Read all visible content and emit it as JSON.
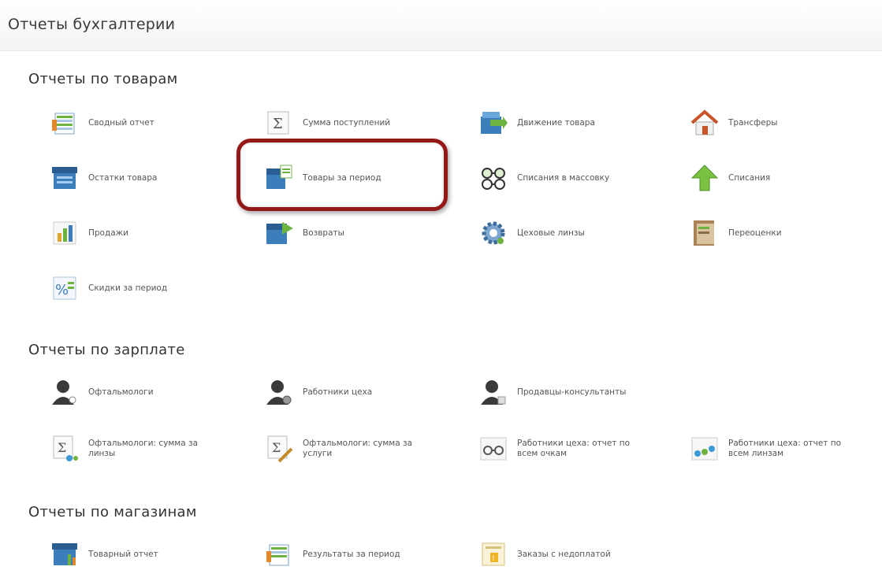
{
  "page": {
    "title": "Отчеты бухгалтерии"
  },
  "sections": [
    {
      "title": "Отчеты по товарам",
      "items": [
        {
          "label": "Сводный отчет",
          "icon": "summary-report-icon"
        },
        {
          "label": "Сумма поступлений",
          "icon": "sigma-icon"
        },
        {
          "label": "Движение товара",
          "icon": "goods-movement-icon"
        },
        {
          "label": "Трансферы",
          "icon": "house-transfer-icon"
        },
        {
          "label": "Остатки товара",
          "icon": "goods-stock-icon"
        },
        {
          "label": "Товары за период",
          "icon": "goods-period-icon"
        },
        {
          "label": "Списания в массовку",
          "icon": "glasses-icon"
        },
        {
          "label": "Списания",
          "icon": "up-arrow-icon"
        },
        {
          "label": "Продажи",
          "icon": "sales-chart-icon"
        },
        {
          "label": "Возвраты",
          "icon": "returns-icon"
        },
        {
          "label": "Цеховые линзы",
          "icon": "gear-icon"
        },
        {
          "label": "Переоценки",
          "icon": "revaluation-icon"
        },
        {
          "label": "Скидки за период",
          "icon": "discount-icon"
        }
      ]
    },
    {
      "title": "Отчеты по зарплате",
      "items": [
        {
          "label": "Офтальмологи",
          "icon": "person-icon"
        },
        {
          "label": "Работники цеха",
          "icon": "person-icon"
        },
        {
          "label": "Продавцы-консультанты",
          "icon": "person-icon"
        },
        {
          "label": "Офтальмологи: сумма за линзы",
          "icon": "sigma-lens-icon"
        },
        {
          "label": "Офтальмологи: сумма за услуги",
          "icon": "sigma-tools-icon"
        },
        {
          "label": "Работники цеха: отчет по всем очкам",
          "icon": "glasses-report-icon"
        },
        {
          "label": "Работники цеха: отчет по всем линзам",
          "icon": "lenses-report-icon"
        }
      ]
    },
    {
      "title": "Отчеты по магазинам",
      "items": [
        {
          "label": "Товарный отчет",
          "icon": "goods-report-icon"
        },
        {
          "label": "Результаты за период",
          "icon": "period-results-icon"
        },
        {
          "label": "Заказы с недоплатой",
          "icon": "underpaid-orders-icon"
        }
      ]
    }
  ],
  "colors": {
    "highlight": "#951818",
    "accent_green": "#5aa82a",
    "accent_blue": "#2f79b8"
  }
}
